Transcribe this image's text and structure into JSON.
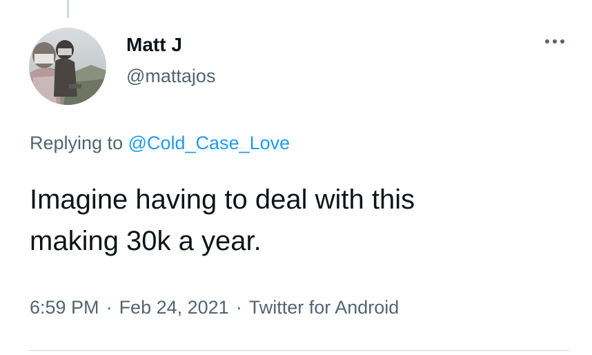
{
  "author": {
    "display_name": "Matt J",
    "handle": "@mattajos",
    "avatar_icon": "user-avatar-photo"
  },
  "actions": {
    "more_icon": "ellipsis-icon"
  },
  "reply": {
    "prefix": "Replying to ",
    "mention": "@Cold_Case_Love"
  },
  "tweet": {
    "lines": [
      "Imagine having to deal with this",
      "making 30k a year."
    ]
  },
  "meta": {
    "time": "6:59 PM",
    "separator": "·",
    "date": "Feb 24, 2021",
    "source": "Twitter for Android"
  },
  "colors": {
    "text_primary": "#0f1419",
    "text_secondary": "#536471",
    "link": "#1d9bf0",
    "divider": "#cfd9de"
  }
}
